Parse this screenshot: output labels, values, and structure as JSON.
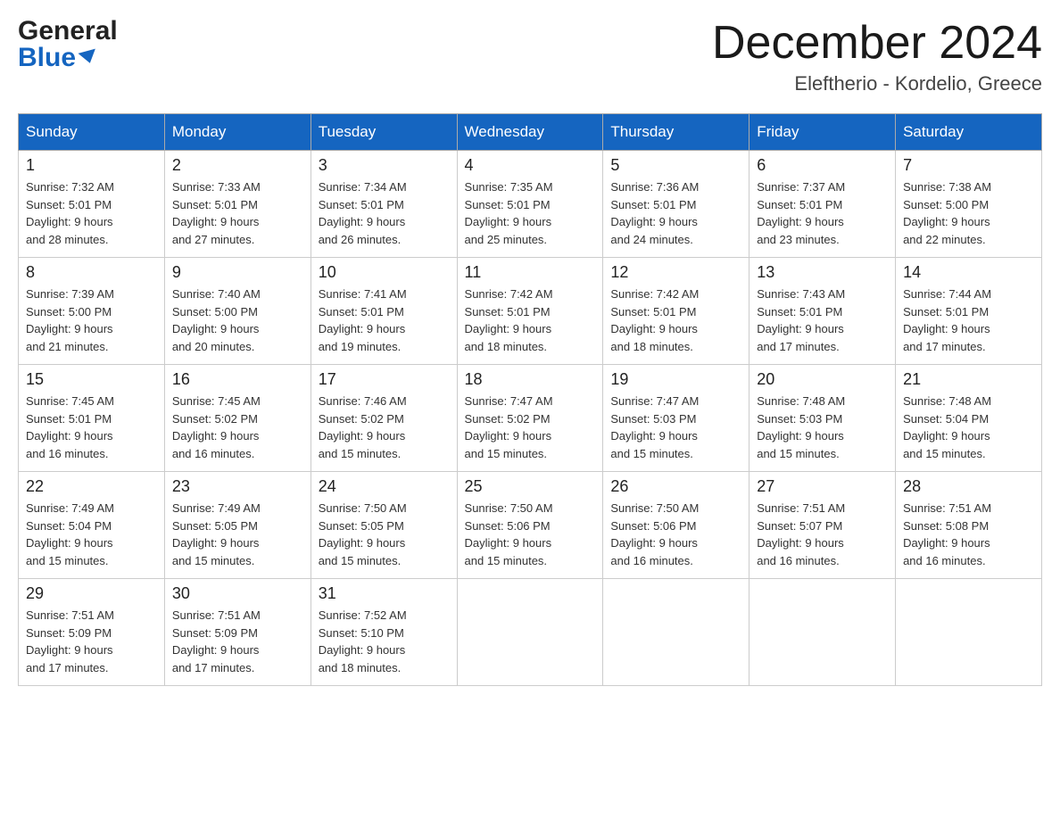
{
  "logo": {
    "line1": "General",
    "line2": "Blue"
  },
  "header": {
    "month": "December 2024",
    "location": "Eleftherio - Kordelio, Greece"
  },
  "days_of_week": [
    "Sunday",
    "Monday",
    "Tuesday",
    "Wednesday",
    "Thursday",
    "Friday",
    "Saturday"
  ],
  "weeks": [
    [
      {
        "date": "1",
        "sunrise": "Sunrise: 7:32 AM",
        "sunset": "Sunset: 5:01 PM",
        "daylight": "Daylight: 9 hours and 28 minutes."
      },
      {
        "date": "2",
        "sunrise": "Sunrise: 7:33 AM",
        "sunset": "Sunset: 5:01 PM",
        "daylight": "Daylight: 9 hours and 27 minutes."
      },
      {
        "date": "3",
        "sunrise": "Sunrise: 7:34 AM",
        "sunset": "Sunset: 5:01 PM",
        "daylight": "Daylight: 9 hours and 26 minutes."
      },
      {
        "date": "4",
        "sunrise": "Sunrise: 7:35 AM",
        "sunset": "Sunset: 5:01 PM",
        "daylight": "Daylight: 9 hours and 25 minutes."
      },
      {
        "date": "5",
        "sunrise": "Sunrise: 7:36 AM",
        "sunset": "Sunset: 5:01 PM",
        "daylight": "Daylight: 9 hours and 24 minutes."
      },
      {
        "date": "6",
        "sunrise": "Sunrise: 7:37 AM",
        "sunset": "Sunset: 5:01 PM",
        "daylight": "Daylight: 9 hours and 23 minutes."
      },
      {
        "date": "7",
        "sunrise": "Sunrise: 7:38 AM",
        "sunset": "Sunset: 5:00 PM",
        "daylight": "Daylight: 9 hours and 22 minutes."
      }
    ],
    [
      {
        "date": "8",
        "sunrise": "Sunrise: 7:39 AM",
        "sunset": "Sunset: 5:00 PM",
        "daylight": "Daylight: 9 hours and 21 minutes."
      },
      {
        "date": "9",
        "sunrise": "Sunrise: 7:40 AM",
        "sunset": "Sunset: 5:00 PM",
        "daylight": "Daylight: 9 hours and 20 minutes."
      },
      {
        "date": "10",
        "sunrise": "Sunrise: 7:41 AM",
        "sunset": "Sunset: 5:01 PM",
        "daylight": "Daylight: 9 hours and 19 minutes."
      },
      {
        "date": "11",
        "sunrise": "Sunrise: 7:42 AM",
        "sunset": "Sunset: 5:01 PM",
        "daylight": "Daylight: 9 hours and 18 minutes."
      },
      {
        "date": "12",
        "sunrise": "Sunrise: 7:42 AM",
        "sunset": "Sunset: 5:01 PM",
        "daylight": "Daylight: 9 hours and 18 minutes."
      },
      {
        "date": "13",
        "sunrise": "Sunrise: 7:43 AM",
        "sunset": "Sunset: 5:01 PM",
        "daylight": "Daylight: 9 hours and 17 minutes."
      },
      {
        "date": "14",
        "sunrise": "Sunrise: 7:44 AM",
        "sunset": "Sunset: 5:01 PM",
        "daylight": "Daylight: 9 hours and 17 minutes."
      }
    ],
    [
      {
        "date": "15",
        "sunrise": "Sunrise: 7:45 AM",
        "sunset": "Sunset: 5:01 PM",
        "daylight": "Daylight: 9 hours and 16 minutes."
      },
      {
        "date": "16",
        "sunrise": "Sunrise: 7:45 AM",
        "sunset": "Sunset: 5:02 PM",
        "daylight": "Daylight: 9 hours and 16 minutes."
      },
      {
        "date": "17",
        "sunrise": "Sunrise: 7:46 AM",
        "sunset": "Sunset: 5:02 PM",
        "daylight": "Daylight: 9 hours and 15 minutes."
      },
      {
        "date": "18",
        "sunrise": "Sunrise: 7:47 AM",
        "sunset": "Sunset: 5:02 PM",
        "daylight": "Daylight: 9 hours and 15 minutes."
      },
      {
        "date": "19",
        "sunrise": "Sunrise: 7:47 AM",
        "sunset": "Sunset: 5:03 PM",
        "daylight": "Daylight: 9 hours and 15 minutes."
      },
      {
        "date": "20",
        "sunrise": "Sunrise: 7:48 AM",
        "sunset": "Sunset: 5:03 PM",
        "daylight": "Daylight: 9 hours and 15 minutes."
      },
      {
        "date": "21",
        "sunrise": "Sunrise: 7:48 AM",
        "sunset": "Sunset: 5:04 PM",
        "daylight": "Daylight: 9 hours and 15 minutes."
      }
    ],
    [
      {
        "date": "22",
        "sunrise": "Sunrise: 7:49 AM",
        "sunset": "Sunset: 5:04 PM",
        "daylight": "Daylight: 9 hours and 15 minutes."
      },
      {
        "date": "23",
        "sunrise": "Sunrise: 7:49 AM",
        "sunset": "Sunset: 5:05 PM",
        "daylight": "Daylight: 9 hours and 15 minutes."
      },
      {
        "date": "24",
        "sunrise": "Sunrise: 7:50 AM",
        "sunset": "Sunset: 5:05 PM",
        "daylight": "Daylight: 9 hours and 15 minutes."
      },
      {
        "date": "25",
        "sunrise": "Sunrise: 7:50 AM",
        "sunset": "Sunset: 5:06 PM",
        "daylight": "Daylight: 9 hours and 15 minutes."
      },
      {
        "date": "26",
        "sunrise": "Sunrise: 7:50 AM",
        "sunset": "Sunset: 5:06 PM",
        "daylight": "Daylight: 9 hours and 16 minutes."
      },
      {
        "date": "27",
        "sunrise": "Sunrise: 7:51 AM",
        "sunset": "Sunset: 5:07 PM",
        "daylight": "Daylight: 9 hours and 16 minutes."
      },
      {
        "date": "28",
        "sunrise": "Sunrise: 7:51 AM",
        "sunset": "Sunset: 5:08 PM",
        "daylight": "Daylight: 9 hours and 16 minutes."
      }
    ],
    [
      {
        "date": "29",
        "sunrise": "Sunrise: 7:51 AM",
        "sunset": "Sunset: 5:09 PM",
        "daylight": "Daylight: 9 hours and 17 minutes."
      },
      {
        "date": "30",
        "sunrise": "Sunrise: 7:51 AM",
        "sunset": "Sunset: 5:09 PM",
        "daylight": "Daylight: 9 hours and 17 minutes."
      },
      {
        "date": "31",
        "sunrise": "Sunrise: 7:52 AM",
        "sunset": "Sunset: 5:10 PM",
        "daylight": "Daylight: 9 hours and 18 minutes."
      },
      null,
      null,
      null,
      null
    ]
  ]
}
